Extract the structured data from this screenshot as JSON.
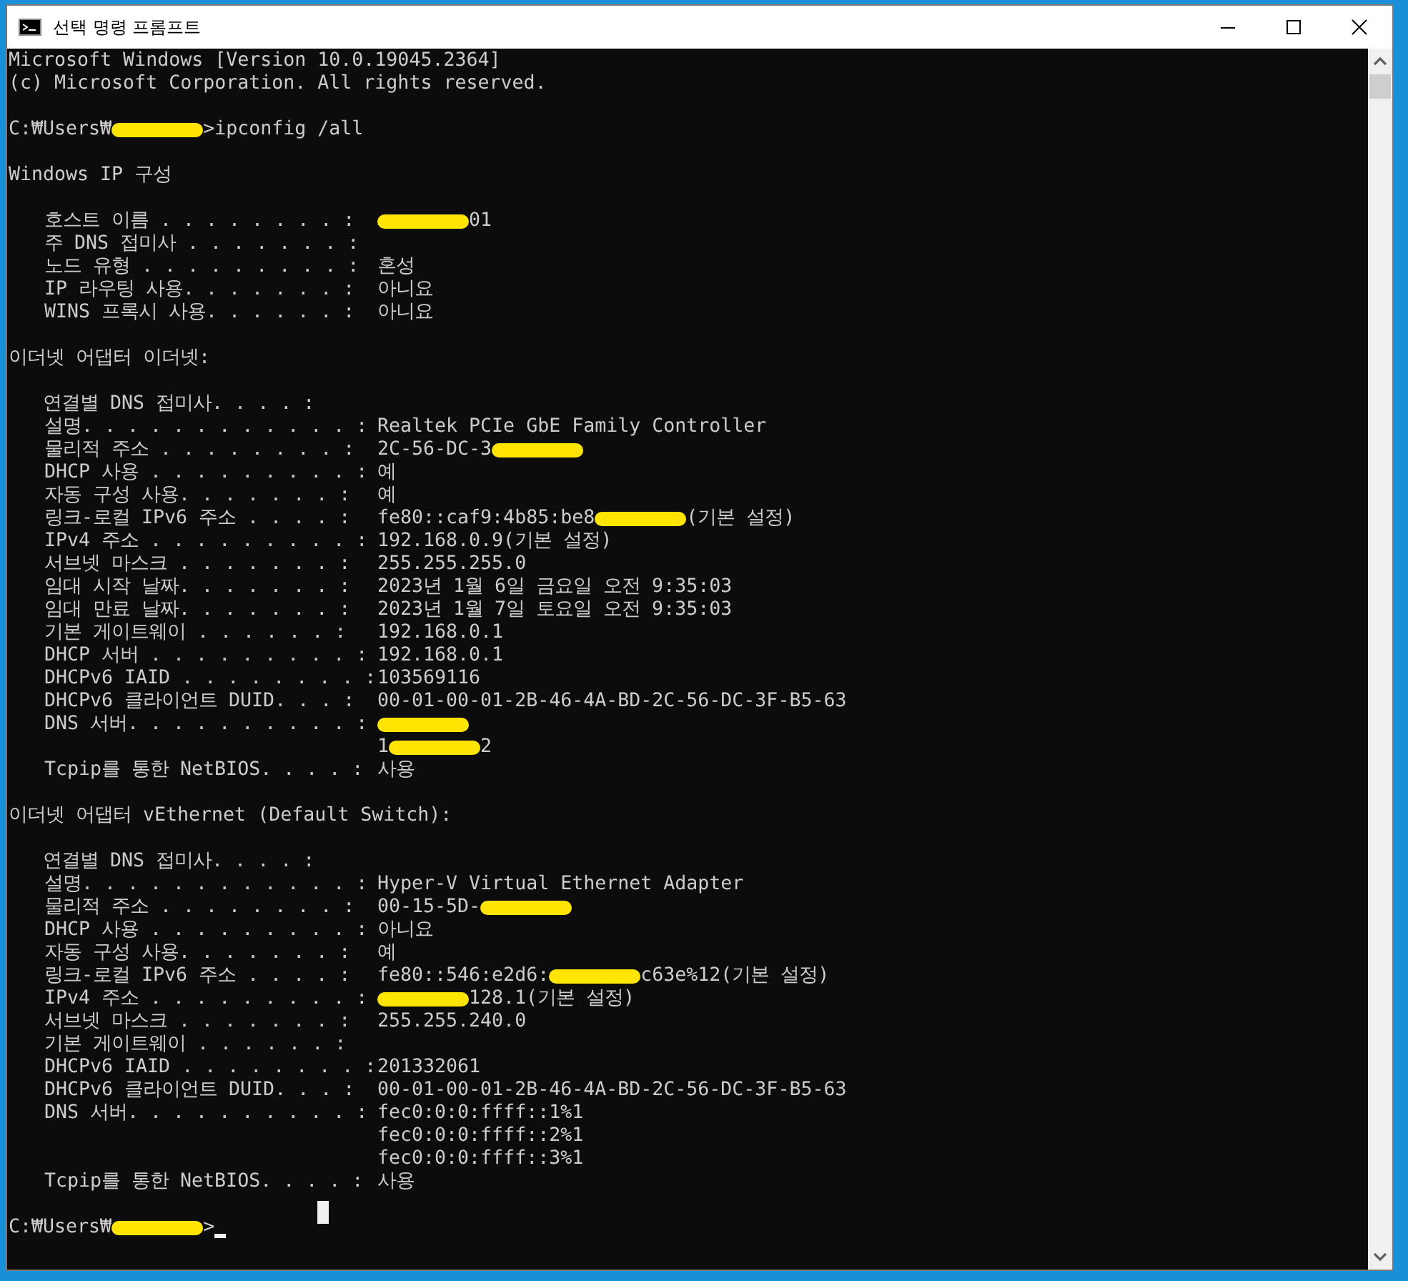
{
  "window": {
    "title": "선택 명령 프롬프트"
  },
  "console": {
    "lines": [
      {
        "kind": "text",
        "parts": [
          {
            "kind": "text",
            "text": "Microsoft Windows [Version 10.0.19045.2364]"
          }
        ]
      },
      {
        "kind": "text",
        "parts": [
          {
            "kind": "text",
            "text": "(c) Microsoft Corporation. All rights reserved."
          }
        ]
      },
      {
        "kind": "blank"
      },
      {
        "kind": "text",
        "parts": [
          {
            "kind": "text",
            "text": "C:₩Users₩"
          },
          {
            "kind": "mark"
          },
          {
            "kind": "text",
            "text": ">ipconfig /all"
          }
        ]
      },
      {
        "kind": "blank"
      },
      {
        "kind": "text",
        "parts": [
          {
            "kind": "text",
            "text": "Windows IP 구성"
          }
        ]
      },
      {
        "kind": "blank"
      },
      {
        "kind": "field",
        "label": "호스트 이름 . . . . . . . . :",
        "parts": [
          {
            "kind": "mark"
          },
          {
            "kind": "text",
            "text": "01"
          }
        ]
      },
      {
        "kind": "field",
        "label": "주 DNS 접미사 . . . . . . . :"
      },
      {
        "kind": "field",
        "label": "노드 유형 . . . . . . . . . :",
        "parts": [
          {
            "kind": "text",
            "text": "혼성"
          }
        ]
      },
      {
        "kind": "field",
        "label": "IP 라우팅 사용. . . . . . . :",
        "parts": [
          {
            "kind": "text",
            "text": "아니요"
          }
        ]
      },
      {
        "kind": "field",
        "label": "WINS 프록시 사용. . . . . . :",
        "parts": [
          {
            "kind": "text",
            "text": "아니요"
          }
        ]
      },
      {
        "kind": "blank"
      },
      {
        "kind": "text",
        "parts": [
          {
            "kind": "text",
            "text": "이더넷 어댑터 이더넷:"
          }
        ]
      },
      {
        "kind": "blank"
      },
      {
        "kind": "text",
        "parts": [
          {
            "kind": "text",
            "text": "   연결별 DNS 접미사. . . . :"
          }
        ]
      },
      {
        "kind": "field",
        "label": "설명. . . . . . . . . . . . :",
        "parts": [
          {
            "kind": "text",
            "text": "Realtek PCIe GbE Family Controller"
          }
        ]
      },
      {
        "kind": "field",
        "label": "물리적 주소 . . . . . . . . :",
        "parts": [
          {
            "kind": "text",
            "text": "2C-56-DC-3"
          },
          {
            "kind": "mark"
          }
        ]
      },
      {
        "kind": "field",
        "label": "DHCP 사용 . . . . . . . . . :",
        "parts": [
          {
            "kind": "text",
            "text": "예"
          }
        ]
      },
      {
        "kind": "field",
        "label": "자동 구성 사용. . . . . . . :",
        "parts": [
          {
            "kind": "text",
            "text": "예"
          }
        ]
      },
      {
        "kind": "field",
        "label": "링크-로컬 IPv6 주소 . . . . :",
        "parts": [
          {
            "kind": "text",
            "text": "fe80::caf9:4b85:be8"
          },
          {
            "kind": "mark"
          },
          {
            "kind": "text",
            "text": "(기본 설정)"
          }
        ]
      },
      {
        "kind": "field",
        "label": "IPv4 주소 . . . . . . . . . :",
        "parts": [
          {
            "kind": "text",
            "text": "192.168.0.9(기본 설정)"
          }
        ]
      },
      {
        "kind": "field",
        "label": "서브넷 마스크 . . . . . . . :",
        "parts": [
          {
            "kind": "text",
            "text": "255.255.255.0"
          }
        ]
      },
      {
        "kind": "field",
        "label": "임대 시작 날짜. . . . . . . :",
        "parts": [
          {
            "kind": "text",
            "text": "2023년 1월 6일 금요일 오전 9:35:03"
          }
        ]
      },
      {
        "kind": "field",
        "label": "임대 만료 날짜. . . . . . . :",
        "parts": [
          {
            "kind": "text",
            "text": "2023년 1월 7일 토요일 오전 9:35:03"
          }
        ]
      },
      {
        "kind": "field",
        "label": "기본 게이트웨이 . . . . . . :",
        "parts": [
          {
            "kind": "text",
            "text": "192.168.0.1"
          }
        ]
      },
      {
        "kind": "field",
        "label": "DHCP 서버 . . . . . . . . . :",
        "parts": [
          {
            "kind": "text",
            "text": "192.168.0.1"
          }
        ]
      },
      {
        "kind": "field",
        "label": "DHCPv6 IAID . . . . . . . . :",
        "parts": [
          {
            "kind": "text",
            "text": "103569116"
          }
        ]
      },
      {
        "kind": "field",
        "label": "DHCPv6 클라이언트 DUID. . . :",
        "parts": [
          {
            "kind": "text",
            "text": "00-01-00-01-2B-46-4A-BD-2C-56-DC-3F-B5-63"
          }
        ]
      },
      {
        "kind": "field",
        "label": "DNS 서버. . . . . . . . . . :",
        "parts": [
          {
            "kind": "mark"
          }
        ]
      },
      {
        "kind": "field",
        "parts": [
          {
            "kind": "text",
            "text": "1"
          },
          {
            "kind": "mark"
          },
          {
            "kind": "text",
            "text": "2"
          }
        ]
      },
      {
        "kind": "field",
        "label": "Tcpip를 통한 NetBIOS. . . . :",
        "parts": [
          {
            "kind": "text",
            "text": "사용"
          }
        ]
      },
      {
        "kind": "blank"
      },
      {
        "kind": "text",
        "parts": [
          {
            "kind": "text",
            "text": "이더넷 어댑터 vEthernet (Default Switch):"
          }
        ]
      },
      {
        "kind": "blank"
      },
      {
        "kind": "text",
        "parts": [
          {
            "kind": "text",
            "text": "   연결별 DNS 접미사. . . . :"
          }
        ]
      },
      {
        "kind": "field",
        "label": "설명. . . . . . . . . . . . :",
        "parts": [
          {
            "kind": "text",
            "text": "Hyper-V Virtual Ethernet Adapter"
          }
        ]
      },
      {
        "kind": "field",
        "label": "물리적 주소 . . . . . . . . :",
        "parts": [
          {
            "kind": "text",
            "text": "00-15-5D-"
          },
          {
            "kind": "mark"
          }
        ]
      },
      {
        "kind": "field",
        "label": "DHCP 사용 . . . . . . . . . :",
        "parts": [
          {
            "kind": "text",
            "text": "아니요"
          }
        ]
      },
      {
        "kind": "field",
        "label": "자동 구성 사용. . . . . . . :",
        "parts": [
          {
            "kind": "text",
            "text": "예"
          }
        ]
      },
      {
        "kind": "field",
        "label": "링크-로컬 IPv6 주소 . . . . :",
        "parts": [
          {
            "kind": "text",
            "text": "fe80::546:e2d6:"
          },
          {
            "kind": "mark"
          },
          {
            "kind": "text",
            "text": "c63e%12(기본 설정)"
          }
        ]
      },
      {
        "kind": "field",
        "label": "IPv4 주소 . . . . . . . . . :",
        "parts": [
          {
            "kind": "mark"
          },
          {
            "kind": "text",
            "text": "128.1(기본 설정)"
          }
        ]
      },
      {
        "kind": "field",
        "label": "서브넷 마스크 . . . . . . . :",
        "parts": [
          {
            "kind": "text",
            "text": "255.255.240.0"
          }
        ]
      },
      {
        "kind": "field",
        "label": "기본 게이트웨이 . . . . . . :"
      },
      {
        "kind": "field",
        "label": "DHCPv6 IAID . . . . . . . . :",
        "parts": [
          {
            "kind": "text",
            "text": "201332061"
          }
        ]
      },
      {
        "kind": "field",
        "label": "DHCPv6 클라이언트 DUID. . . :",
        "parts": [
          {
            "kind": "text",
            "text": "00-01-00-01-2B-46-4A-BD-2C-56-DC-3F-B5-63"
          }
        ]
      },
      {
        "kind": "field",
        "label": "DNS 서버. . . . . . . . . . :",
        "parts": [
          {
            "kind": "text",
            "text": "fec0:0:0:ffff::1%1"
          }
        ]
      },
      {
        "kind": "field",
        "parts": [
          {
            "kind": "text",
            "text": "fec0:0:0:ffff::2%1"
          }
        ]
      },
      {
        "kind": "field",
        "parts": [
          {
            "kind": "text",
            "text": "fec0:0:0:ffff::3%1"
          }
        ]
      },
      {
        "kind": "field",
        "label": "Tcpip를 통한 NetBIOS. . . . :",
        "parts": [
          {
            "kind": "text",
            "text": "사용"
          }
        ]
      },
      {
        "kind": "blank",
        "cursor": true
      },
      {
        "kind": "text",
        "cursor": true,
        "parts": [
          {
            "kind": "text",
            "text": "C:₩Users₩"
          },
          {
            "kind": "mark"
          },
          {
            "kind": "text",
            "text": ">"
          }
        ]
      }
    ]
  }
}
